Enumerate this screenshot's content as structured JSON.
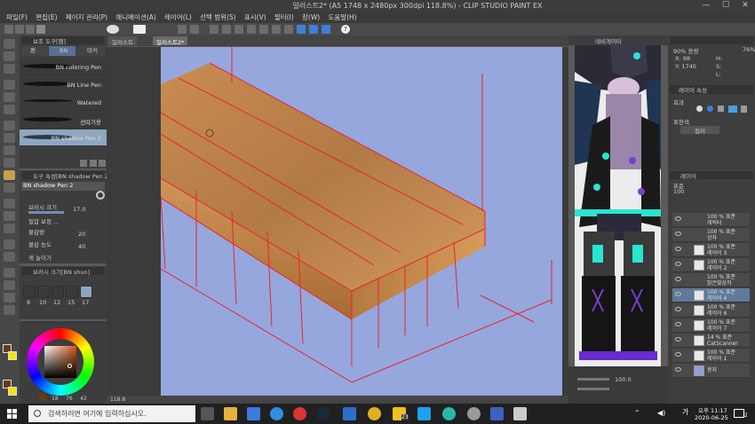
{
  "window": {
    "title": "일러스트2* (A5 1748 x 2480px 300dpi 118.8%) - CLIP STUDIO PAINT EX",
    "minimize": "—",
    "maximize": "☐",
    "close": "✕"
  },
  "menu": [
    "파일(F)",
    "편집(E)",
    "페이지 관리(P)",
    "애니메이션(A)",
    "레이어(L)",
    "선택 범위(S)",
    "표시(V)",
    "필터(I)",
    "창(W)",
    "도움말(H)"
  ],
  "subtool_panel": {
    "title": "보조 도구[펜]",
    "tabs": [
      "펜",
      "BN",
      "마커"
    ],
    "brushes": [
      "BN coloring Pen",
      "BN Line Pen",
      "Watered",
      "선따기용",
      "BN shadow Pen 2"
    ]
  },
  "tool_property": {
    "title": "도구 속성[BN shadow Pen 2]",
    "brush_name": "BN shadow Pen 2",
    "rows": [
      {
        "label": "브러시 크기",
        "value": "17.0"
      },
      {
        "label": "필압 보정 ...",
        "value": ""
      },
      {
        "label": "물감량",
        "value": "20"
      },
      {
        "label": "물감 농도",
        "value": "40"
      },
      {
        "label": "색 늘이기",
        "value": ""
      }
    ]
  },
  "brush_size": {
    "title": "브러시 크기[BN shun]",
    "sizes": [
      "8",
      "10",
      "12",
      "15",
      "17"
    ]
  },
  "color_panel": {
    "readout": [
      "18",
      "76",
      "42"
    ]
  },
  "canvas": {
    "tabs": [
      "일러스트",
      "일러스트2*"
    ],
    "zoom": "118.8"
  },
  "navigator": {
    "tab": "네비게이터",
    "zoom": "100.0"
  },
  "info_panel": {
    "label": "서브 뷰",
    "size": "90% 용량",
    "x": "X: 98",
    "y": "Y: 1740",
    "h": "H:",
    "s": "S:",
    "l": "L:",
    "pct": "76%"
  },
  "layer_property": {
    "title": "레이어 속성",
    "effect": "효과",
    "expression": "표현색",
    "color": "컬러"
  },
  "layers": {
    "title": "레이어",
    "blend": "표준",
    "opacity": "100",
    "items": [
      {
        "line1": "100 % 표준",
        "line2": "캐릭터"
      },
      {
        "line1": "100 % 표준",
        "line2": "상자"
      },
      {
        "line1": "100 % 표준",
        "line2": "레이어 3"
      },
      {
        "line1": "100 % 표준",
        "line2": "레이어 2"
      },
      {
        "line1": "100 % 표준",
        "line2": "밝은빛상자"
      },
      {
        "line1": "100 % 표준",
        "line2": "레이어 4"
      },
      {
        "line1": "100 % 표준",
        "line2": "레이어 6"
      },
      {
        "line1": "100 % 표준",
        "line2": "레이어 7"
      },
      {
        "line1": "14 % 표준",
        "line2": "CatScanner"
      },
      {
        "line1": "100 % 표준",
        "line2": "레이어 1"
      },
      {
        "line1": "",
        "line2": "용지"
      }
    ]
  },
  "taskbar": {
    "search_placeholder": "검색하려면 여기에 입력하십시오.",
    "time": "오후 11:17",
    "date": "2020-06-25",
    "ime": "가",
    "notification_count": "2",
    "badge": "23"
  },
  "colors": {
    "canvas_bg": "#96a7de",
    "wood": "#c58a4e",
    "guide_red": "#e8262e",
    "accent_cyan": "#27e6d0"
  }
}
